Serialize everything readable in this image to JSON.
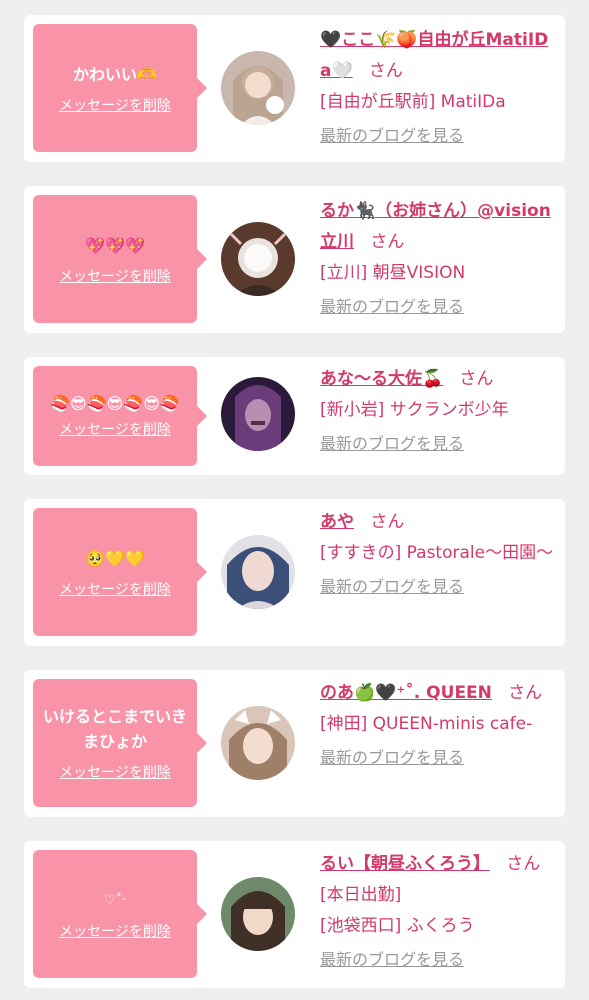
{
  "entries": [
    {
      "message": "かわいい🫶",
      "delete_label": "メッセージを削除",
      "name": "🖤ここ🌾🍑自由が丘MatiIDa🤍",
      "honorific": "さん",
      "shop": "[自由が丘駅前] MatiIDa",
      "blog_label": "最新のブログを見る"
    },
    {
      "message": "💖💖💖",
      "delete_label": "メッセージを削除",
      "name": "るか🐈‍⬛（お姉さん）@vision立川",
      "honorific": "さん",
      "shop": "[立川] 朝昼VISION",
      "blog_label": "最新のブログを見る"
    },
    {
      "message": "🍣😎🍣😎🍣😎🍣",
      "delete_label": "メッセージを削除",
      "name": "あな〜る大佐🍒",
      "honorific": "さん",
      "shop": "[新小岩] サクランボ少年",
      "blog_label": "最新のブログを見る"
    },
    {
      "message": "🥺💛💛",
      "delete_label": "メッセージを削除",
      "name": "あや",
      "honorific": "さん",
      "shop": "[すすきの] Pastorale〜田園〜",
      "blog_label": "最新のブログを見る"
    },
    {
      "message": "いけるとこまでいきまひょか",
      "delete_label": "メッセージを削除",
      "name": "のあ🍏🖤⁺˚. QUEEN",
      "honorific": "さん",
      "shop": "[神田] QUEEN-minis cafe-",
      "blog_label": "最新のブログを見る"
    },
    {
      "message": "♡˚‧",
      "delete_label": "メッセージを削除",
      "name": "るい【朝昼ふくろう】",
      "honorific": "さん[本日出勤]",
      "shop": "[池袋西口] ふくろう",
      "blog_label": "最新のブログを見る"
    }
  ]
}
